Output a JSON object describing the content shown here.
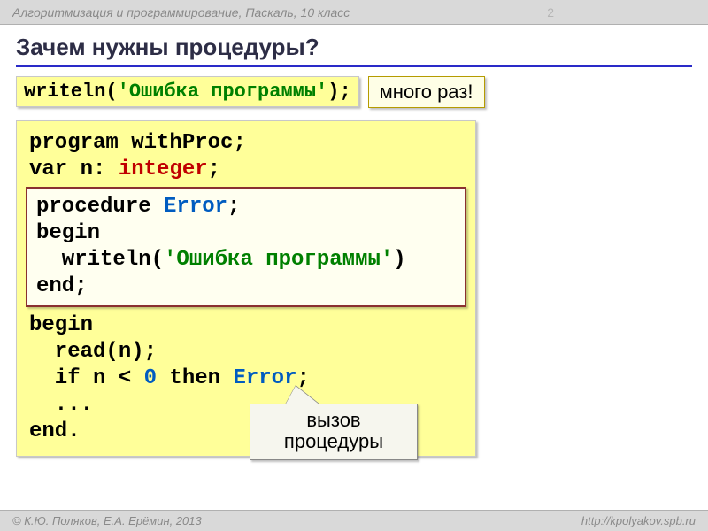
{
  "top": {
    "title": "Алгоритмизация и программирование, Паскаль, 10 класс",
    "page": "2"
  },
  "heading": "Зачем нужны процедуры?",
  "inline_code": {
    "p1": "writeln(",
    "str": "'Ошибка программы'",
    "p2": ");"
  },
  "callout1": "много раз!",
  "big": {
    "l1a": "program ",
    "l1b": "withProc",
    "l1c": ";",
    "l2a": "var n: ",
    "l2b": "integer",
    "l2c": ";",
    "ib_l1a": "procedure ",
    "ib_l1b": "Error",
    "ib_l1c": ";",
    "ib_l2": "begin",
    "ib_l3a": "  writeln(",
    "ib_l3b": "'Ошибка программы'",
    "ib_l3c": ")",
    "ib_l4": "end;",
    "l5": "begin",
    "l6": "  read(n);",
    "l7a": "  if n < ",
    "l7b": "0",
    "l7c": " then ",
    "l7d": "Error",
    "l7e": ";",
    "l8": "  ...",
    "l9": "end."
  },
  "callout2_line1": "вызов",
  "callout2_line2": "процедуры",
  "footer": {
    "copy": "© К.Ю. Поляков, Е.А. Ерёмин, 2013",
    "url": "http://kpolyakov.spb.ru"
  }
}
